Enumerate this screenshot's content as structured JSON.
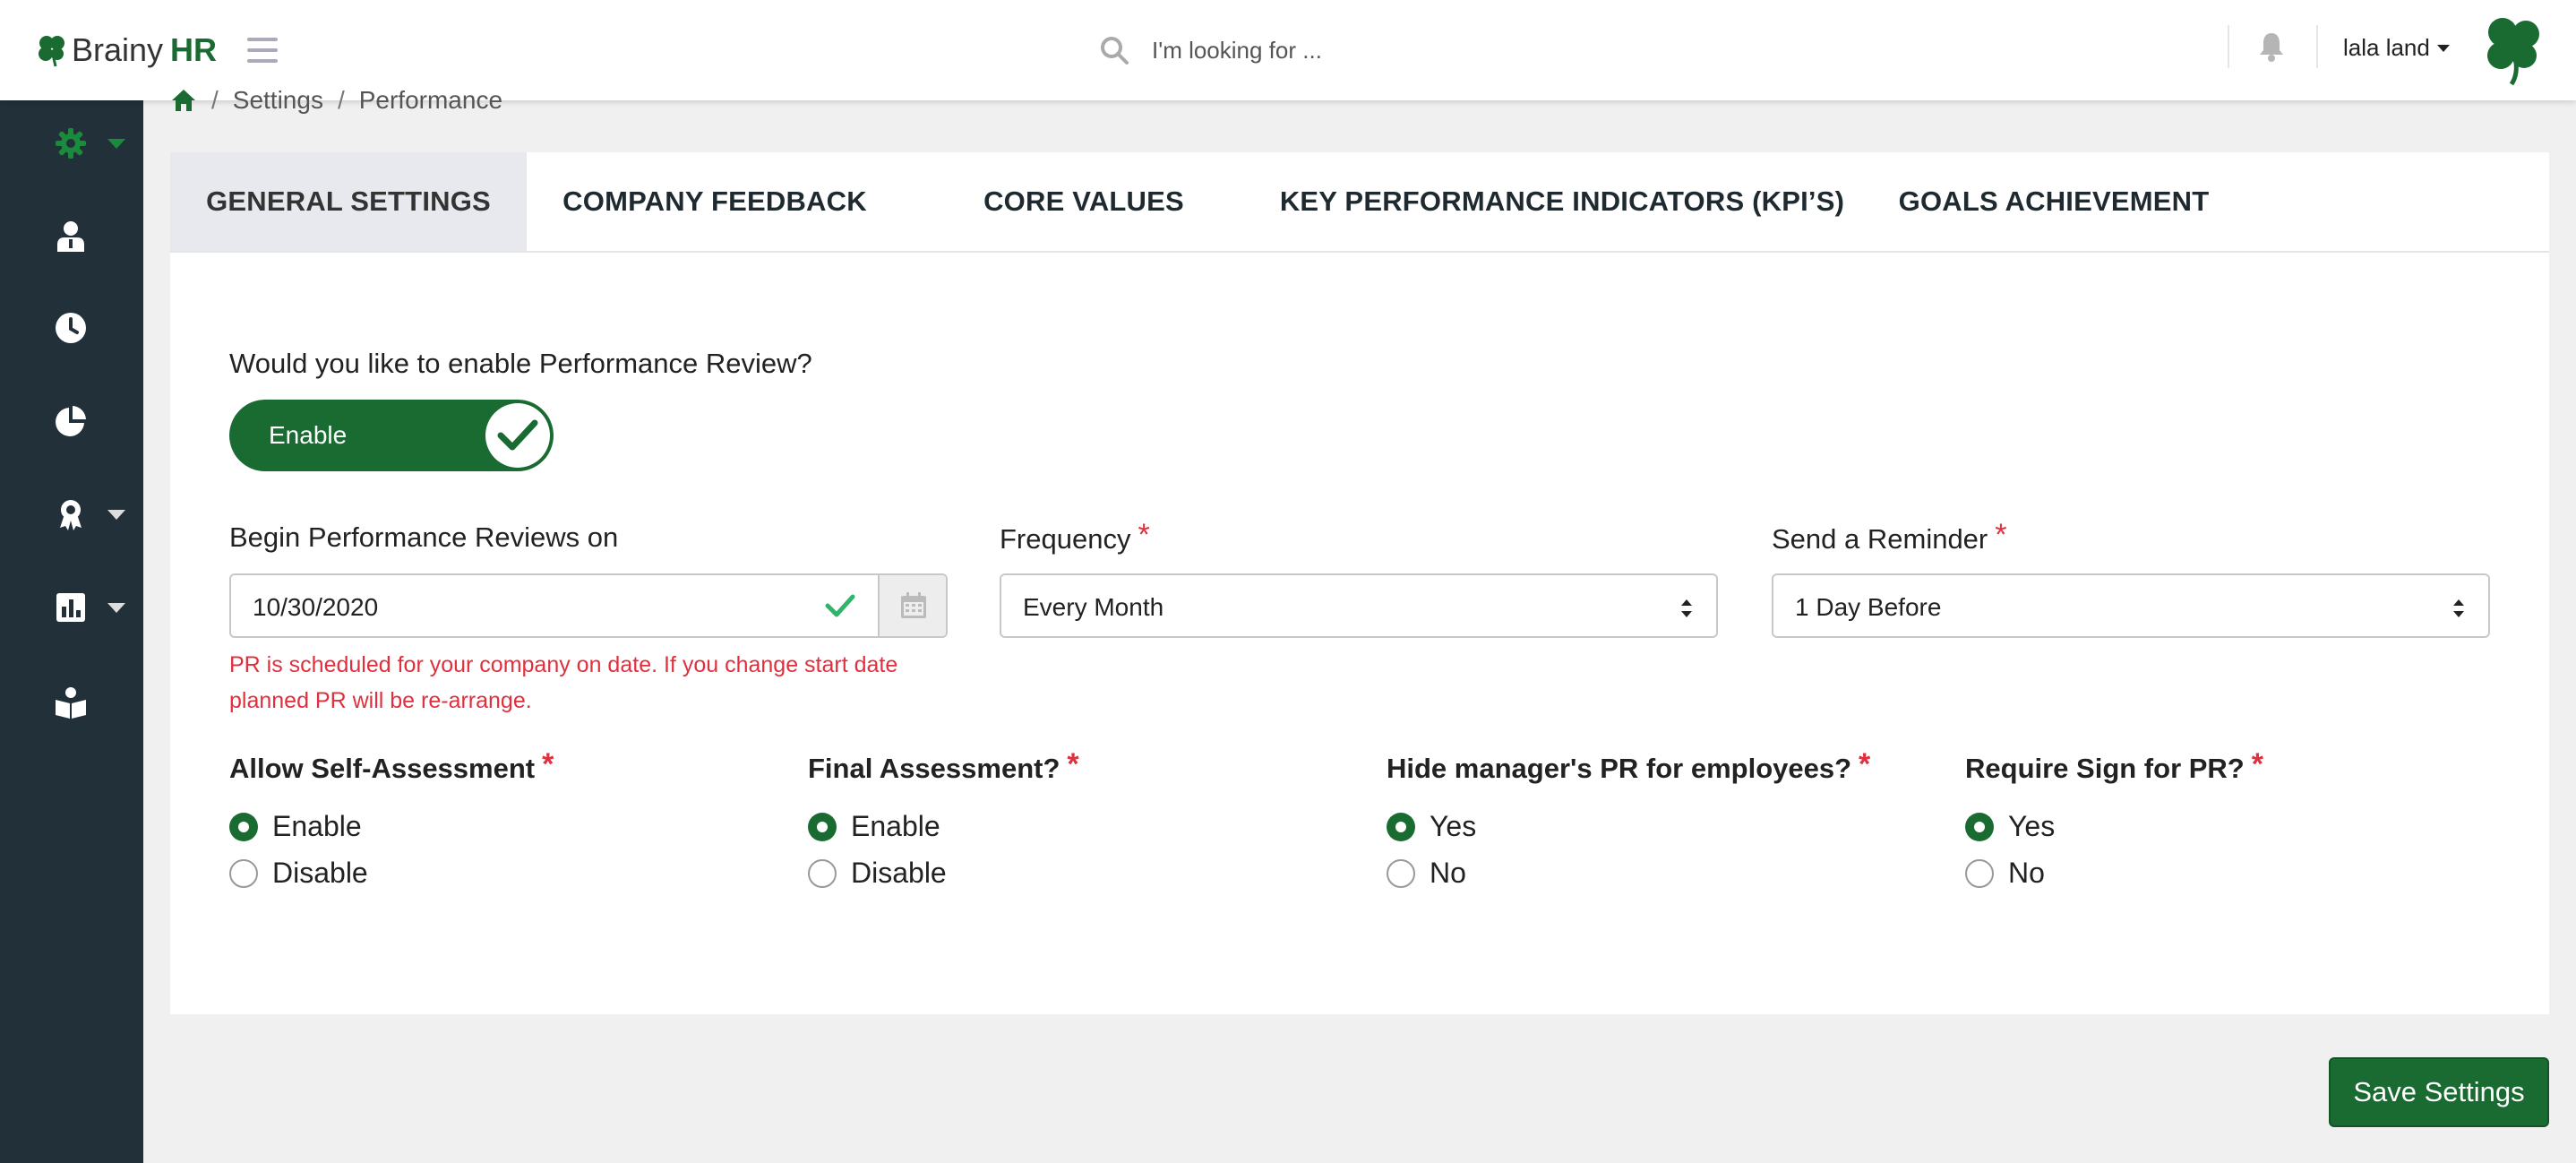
{
  "app": {
    "logo_brand": "Brainy",
    "logo_suffix": "HR",
    "search_placeholder": "I'm looking for ...",
    "user_name": "lala land",
    "accent_color": "#1a6b32"
  },
  "sidebar": {
    "items": [
      {
        "icon": "gear-icon",
        "has_dropdown": true,
        "active": true
      },
      {
        "icon": "user-icon",
        "has_dropdown": false
      },
      {
        "icon": "clock-icon",
        "has_dropdown": false
      },
      {
        "icon": "pie-chart-icon",
        "has_dropdown": false
      },
      {
        "icon": "award-icon",
        "has_dropdown": true
      },
      {
        "icon": "bar-chart-icon",
        "has_dropdown": true
      },
      {
        "icon": "book-reader-icon",
        "has_dropdown": false
      }
    ]
  },
  "breadcrumb": {
    "items": [
      "Settings",
      "Performance"
    ]
  },
  "tabs": [
    {
      "label": "GENERAL SETTINGS",
      "active": true
    },
    {
      "label": "COMPANY FEEDBACK",
      "active": false
    },
    {
      "label": "CORE VALUES",
      "active": false
    },
    {
      "label": "KEY PERFORMANCE INDICATORS (KPI’S)",
      "active": false
    },
    {
      "label": "GOALS ACHIEVEMENT",
      "active": false
    }
  ],
  "form": {
    "enable_question": "Would you like to enable Performance Review?",
    "toggle_label": "Enable",
    "toggle_on": true,
    "begin_label": "Begin Performance Reviews on",
    "begin_value": "10/30/2020",
    "frequency_label": "Frequency",
    "frequency_value": "Every Month",
    "reminder_label": "Send a Reminder",
    "reminder_value": "1 Day Before",
    "required_mark": "*",
    "warning": "PR is scheduled for your company on date. If you change start date planned PR will be re-arrange.",
    "radio_groups": [
      {
        "label": "Allow Self-Assessment",
        "options": [
          "Enable",
          "Disable"
        ],
        "selected": 0
      },
      {
        "label": "Final Assessment?",
        "options": [
          "Enable",
          "Disable"
        ],
        "selected": 0
      },
      {
        "label": "Hide manager's PR for employees?",
        "options": [
          "Yes",
          "No"
        ],
        "selected": 0
      },
      {
        "label": "Require Sign for PR?",
        "options": [
          "Yes",
          "No"
        ],
        "selected": 0
      }
    ]
  },
  "save_label": "Save Settings"
}
